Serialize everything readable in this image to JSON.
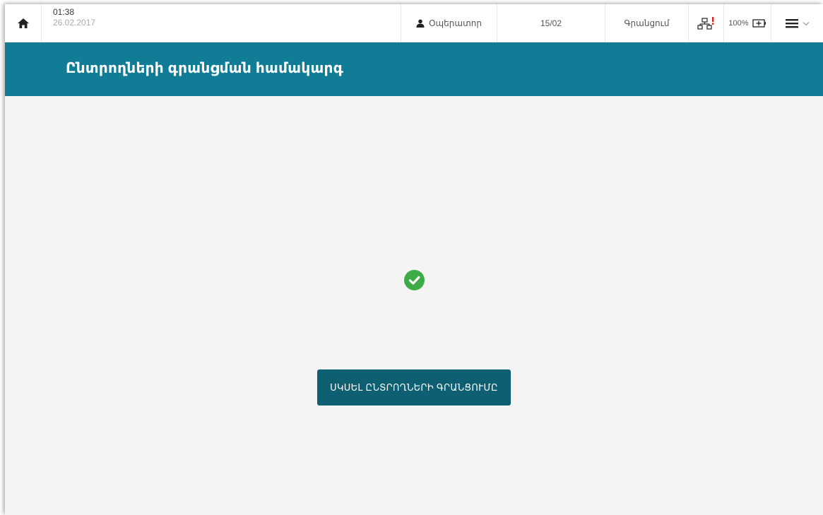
{
  "status_bar": {
    "time": "01:38",
    "date": "26.02.2017",
    "operator_label": "Օպերատոր",
    "counter": "15/02",
    "mode_label": "Գրանցում",
    "battery_percent": "100%"
  },
  "icons": {
    "home": "home-icon",
    "user": "user-icon",
    "network": "network-error-icon",
    "battery": "battery-charging-icon",
    "menu": "hamburger-menu-icon",
    "success": "check-circle-icon"
  },
  "banner": {
    "title": "Ընտրողների գրանցման համակարգ"
  },
  "main": {
    "start_button_label": "ՍԿՍԵԼ ԸՆՏՐՈՂՆԵՐԻ ԳՐԱՆՑՈՒՄԸ"
  },
  "colors": {
    "banner": "#107c96",
    "button": "#0f5f73",
    "success": "#3dab46",
    "alert": "#e02020"
  }
}
